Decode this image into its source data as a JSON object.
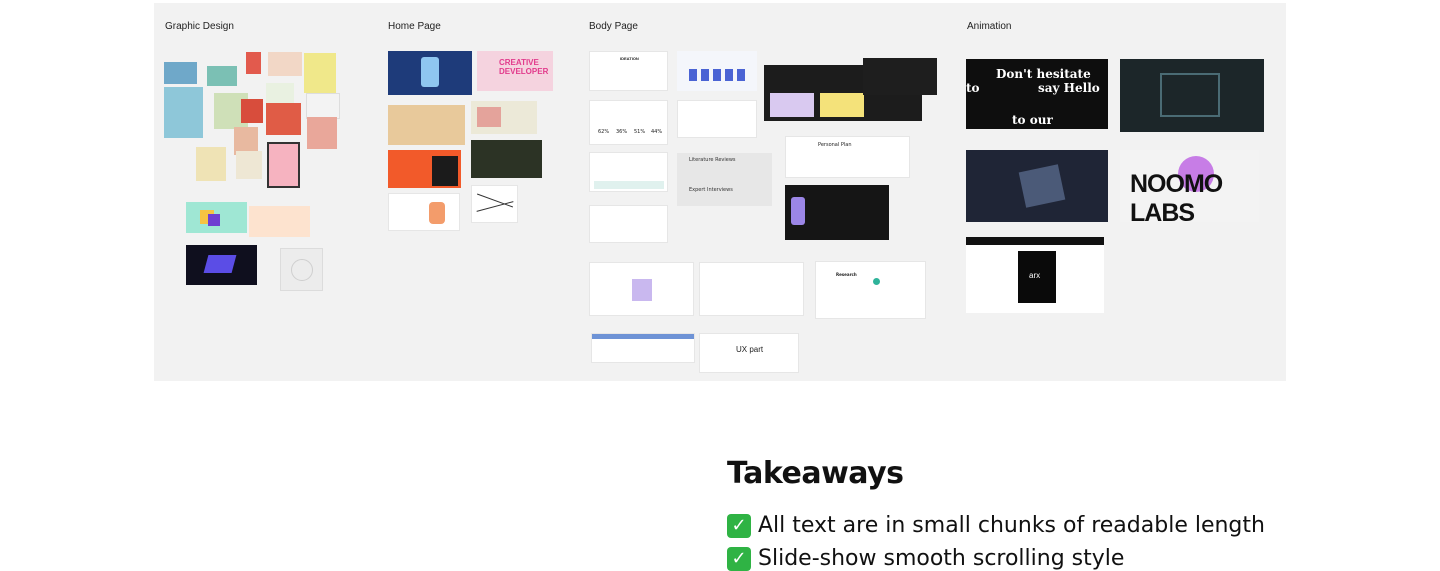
{
  "board": {
    "columns": [
      {
        "title": "Graphic Design"
      },
      {
        "title": "Home Page"
      },
      {
        "title": "Body Page"
      },
      {
        "title": "Animation"
      }
    ]
  },
  "thumbs": {
    "creative_dev": "CREATIVE DEVELOPER",
    "ux_part": "UX part",
    "dont_hesitate": "Don't hesitate",
    "say_hello": "say Hello",
    "to": "to",
    "to_our": "to our",
    "noomo": "NOOMO LABS",
    "arx": "arx",
    "literature": "Literature Reviews",
    "expert": "Expert Interviews",
    "personal_plan": "Personal Plan",
    "ideation": "IDEATION",
    "stat1": "62%",
    "stat2": "36%",
    "stat3": "51%",
    "stat4": "44%",
    "research": "Research"
  },
  "takeaways": {
    "title": "Takeaways",
    "items": [
      "All text are in small chunks of readable length",
      "Slide-show smooth scrolling style"
    ]
  },
  "colors": {
    "check_green": "#2fb344",
    "board_bg": "#f2f2f2"
  }
}
